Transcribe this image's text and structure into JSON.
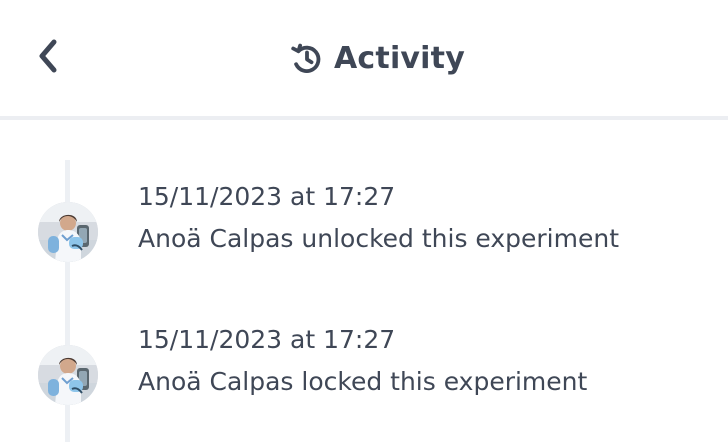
{
  "header": {
    "title": "Activity",
    "back_icon": "chevron-left-icon",
    "title_icon": "history-icon"
  },
  "activities": [
    {
      "timestamp": "15/11/2023 at 17:27",
      "message": "Anoä Calpas unlocked this experiment",
      "avatar_icon": "user-avatar"
    },
    {
      "timestamp": "15/11/2023 at 17:27",
      "message": "Anoä Calpas locked this experiment",
      "avatar_icon": "user-avatar"
    }
  ],
  "colors": {
    "text": "#3f4756",
    "divider": "#eceef2",
    "timeline": "#edf0f4",
    "background": "#ffffff"
  }
}
